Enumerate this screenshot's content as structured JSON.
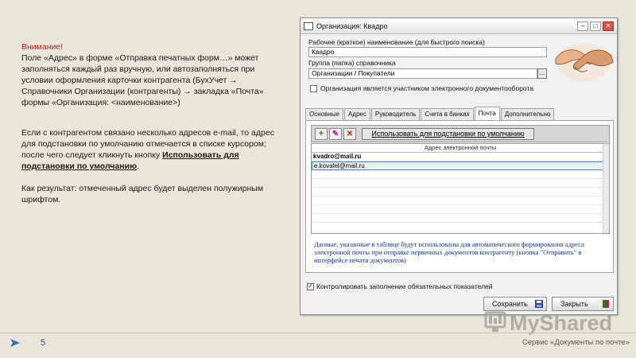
{
  "slide": {
    "warning_title": "Внимание!",
    "paragraph1": "Поле «Адрес» в форме «Отправка печатных форм…» может заполняться каждый раз вручную, или автозаполняться при условии оформления карточки контрагента (БухУчет → Справочники Организации (контрагенты) → закладка «Почта» формы «Организация: <наименование>)",
    "paragraph2_start": "Если с контрагентом связано несколько адресов e-mail, то адрес для подстановки по умолчанию отмечается в списке курсором; после чего следует кликнуть кнопку ",
    "paragraph2_link": "Использовать для подстановки по умолчанию",
    "paragraph2_end": ".",
    "paragraph3": "Как результат: отмеченный адрес будет выделен полужирным шрифтом.",
    "page_number": "5",
    "footer": "Сервис «Документы по почте»",
    "watermark": "MyShared"
  },
  "window": {
    "title": "Организация: Квадро",
    "work_name_label": "Рабочее (краткое) наименование (для быстрого поиска)",
    "work_name_value": "Квадро",
    "group_label": "Группа (папка) справочника",
    "group_value": "Организации / Покупатели",
    "group_picker": "...",
    "edo_checkbox_label": "Организация является участником электронного документооборота",
    "edo_checked": false,
    "tabs": [
      {
        "label": "Основные",
        "active": false
      },
      {
        "label": "Адрес",
        "active": false
      },
      {
        "label": "Руководитель",
        "active": false
      },
      {
        "label": "Счета в банках",
        "active": false
      },
      {
        "label": "Почта",
        "active": true
      },
      {
        "label": "Дополнительно",
        "active": false
      }
    ],
    "toolbar": {
      "add": "+",
      "edit": "✎",
      "delete": "✕",
      "default_button": "Использовать для подстановки по умолчанию"
    },
    "grid": {
      "header": "Адрес электронной почты",
      "rows": [
        {
          "value": "kvadro@mail.ru",
          "bold": true,
          "selected": false
        },
        {
          "value": "e.kovalel@mail.ru",
          "bold": false,
          "selected": true
        }
      ]
    },
    "note": "Данные, указанные в таблице будут использованы для автоматического формирования адреса электронной почты при отправке первичных документов контрагенту (кнопка \"Отправить\" в интерфейсе печати документов)",
    "control_checkbox_label": "Контролировать заполнение обязательных показателей",
    "control_checked": true,
    "save_button": "Сохранить",
    "close_button": "Закрыть"
  },
  "colors": {
    "warning": "#c01818",
    "note_text": "#1a2f8f",
    "background": "#e9e6d9"
  }
}
